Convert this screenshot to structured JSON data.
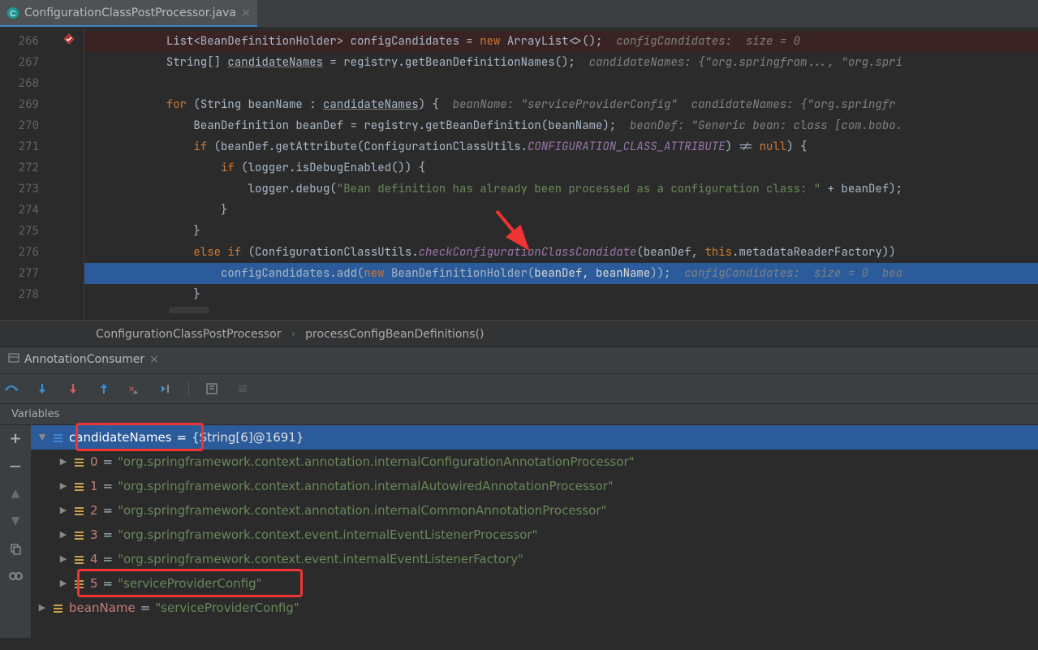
{
  "tab": {
    "file_name": "ConfigurationClassPostProcessor.java"
  },
  "editor": {
    "lines": [
      "266",
      "267",
      "268",
      "269",
      "270",
      "271",
      "272",
      "273",
      "274",
      "275",
      "276",
      "277",
      "278"
    ]
  },
  "code": {
    "l266_a": "List<BeanDefinitionHolder> configCandidates = ",
    "l266_b": "new",
    "l266_c": " ArrayList<>();",
    "l266_h": "  configCandidates:  size = 0",
    "l267_a": "String[] ",
    "l267_b": "candidateNames",
    "l267_c": " = registry.getBeanDefinitionNames();",
    "l267_h": "  candidateNames: {\"org.springfram..., \"org.spri",
    "l269_a": "for",
    "l269_b": " (String beanName : ",
    "l269_c": "candidateNames",
    "l269_d": ") {",
    "l269_h": "  beanName: \"serviceProviderConfig\"  candidateNames: {\"org.springfr",
    "l270_a": "BeanDefinition beanDef = registry.getBeanDefinition(beanName);",
    "l270_h": "  beanDef: \"Generic bean: class [com.bobo.",
    "l271_a": "if",
    "l271_b": " (beanDef.getAttribute(ConfigurationClassUtils.",
    "l271_c": "CONFIGURATION_CLASS_ATTRIBUTE",
    "l271_d": ") != ",
    "l271_e": "null",
    "l271_f": ") {",
    "l272_a": "if",
    "l272_b": " (logger.isDebugEnabled()) {",
    "l273_a": "logger.debug(",
    "l273_b": "\"Bean definition has already been processed as a configuration class: \"",
    "l273_c": " + beanDef);",
    "l274_a": "}",
    "l275_a": "}",
    "l276_a": "else if",
    "l276_b": " (ConfigurationClassUtils.",
    "l276_c": "checkConfigurationClassCandidate",
    "l276_d": "(beanDef, ",
    "l276_e": "this",
    "l276_f": ".metadataReaderFactory)) ",
    "l277_a": "configCandidates.add(",
    "l277_b": "new",
    "l277_c": " BeanDefinitionHolder(",
    "l277_d": "beanDef, beanName",
    "l277_e": "));",
    "l277_h": "  configCandidates:  size = 0  bea",
    "l278_a": "}"
  },
  "breadcrumb": {
    "class": "ConfigurationClassPostProcessor",
    "method": "processConfigBeanDefinitions()"
  },
  "debug": {
    "tab_label": "AnnotationConsumer",
    "variables_title": "Variables"
  },
  "tree": {
    "root_name": "candidateNames",
    "root_eq": " = ",
    "root_val": "{String[6]@1691}",
    "items": [
      {
        "idx": "0",
        "val": "\"org.springframework.context.annotation.internalConfigurationAnnotationProcessor\""
      },
      {
        "idx": "1",
        "val": "\"org.springframework.context.annotation.internalAutowiredAnnotationProcessor\""
      },
      {
        "idx": "2",
        "val": "\"org.springframework.context.annotation.internalCommonAnnotationProcessor\""
      },
      {
        "idx": "3",
        "val": "\"org.springframework.context.event.internalEventListenerProcessor\""
      },
      {
        "idx": "4",
        "val": "\"org.springframework.context.event.internalEventListenerFactory\""
      },
      {
        "idx": "5",
        "val": "\"serviceProviderConfig\""
      }
    ],
    "bean_name_label": "beanName",
    "bean_name_eq": " = ",
    "bean_name_val": "\"serviceProviderConfig\""
  }
}
